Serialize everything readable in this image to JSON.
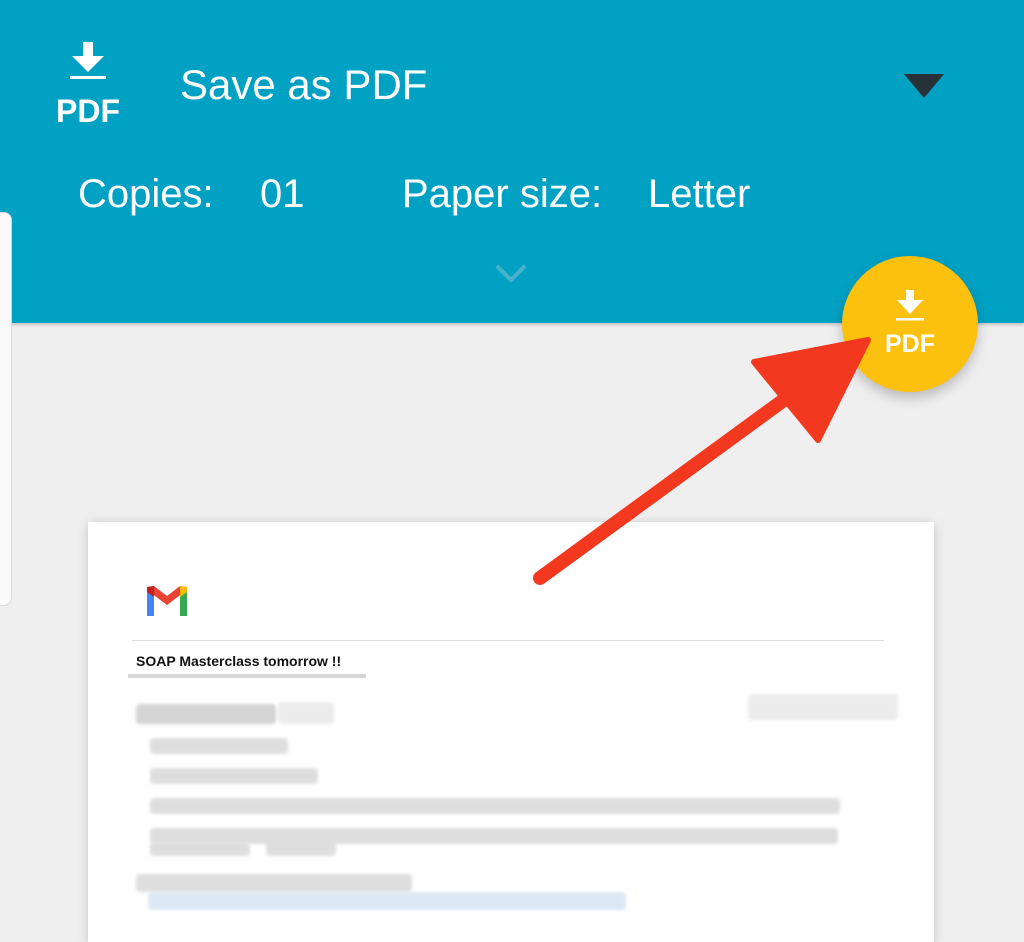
{
  "header": {
    "printer_icon_label": "PDF",
    "printer_name": "Save as PDF",
    "copies_label": "Copies:",
    "copies_value": "01",
    "paper_size_label": "Paper size:",
    "paper_size_value": "Letter"
  },
  "fab": {
    "icon_label": "PDF"
  },
  "preview": {
    "email_subject": "SOAP Masterclass tomorrow !!"
  },
  "colors": {
    "header_bg": "#00a1c3",
    "fab_bg": "#fcc00f",
    "annotation_arrow": "#f2381f",
    "page_bg": "#efefef"
  },
  "icons": {
    "printer": "pdf-download-icon",
    "dropdown": "triangle-down-icon",
    "expand": "chevron-down-icon",
    "fab": "pdf-download-icon",
    "logo": "gmail-logo-icon"
  }
}
